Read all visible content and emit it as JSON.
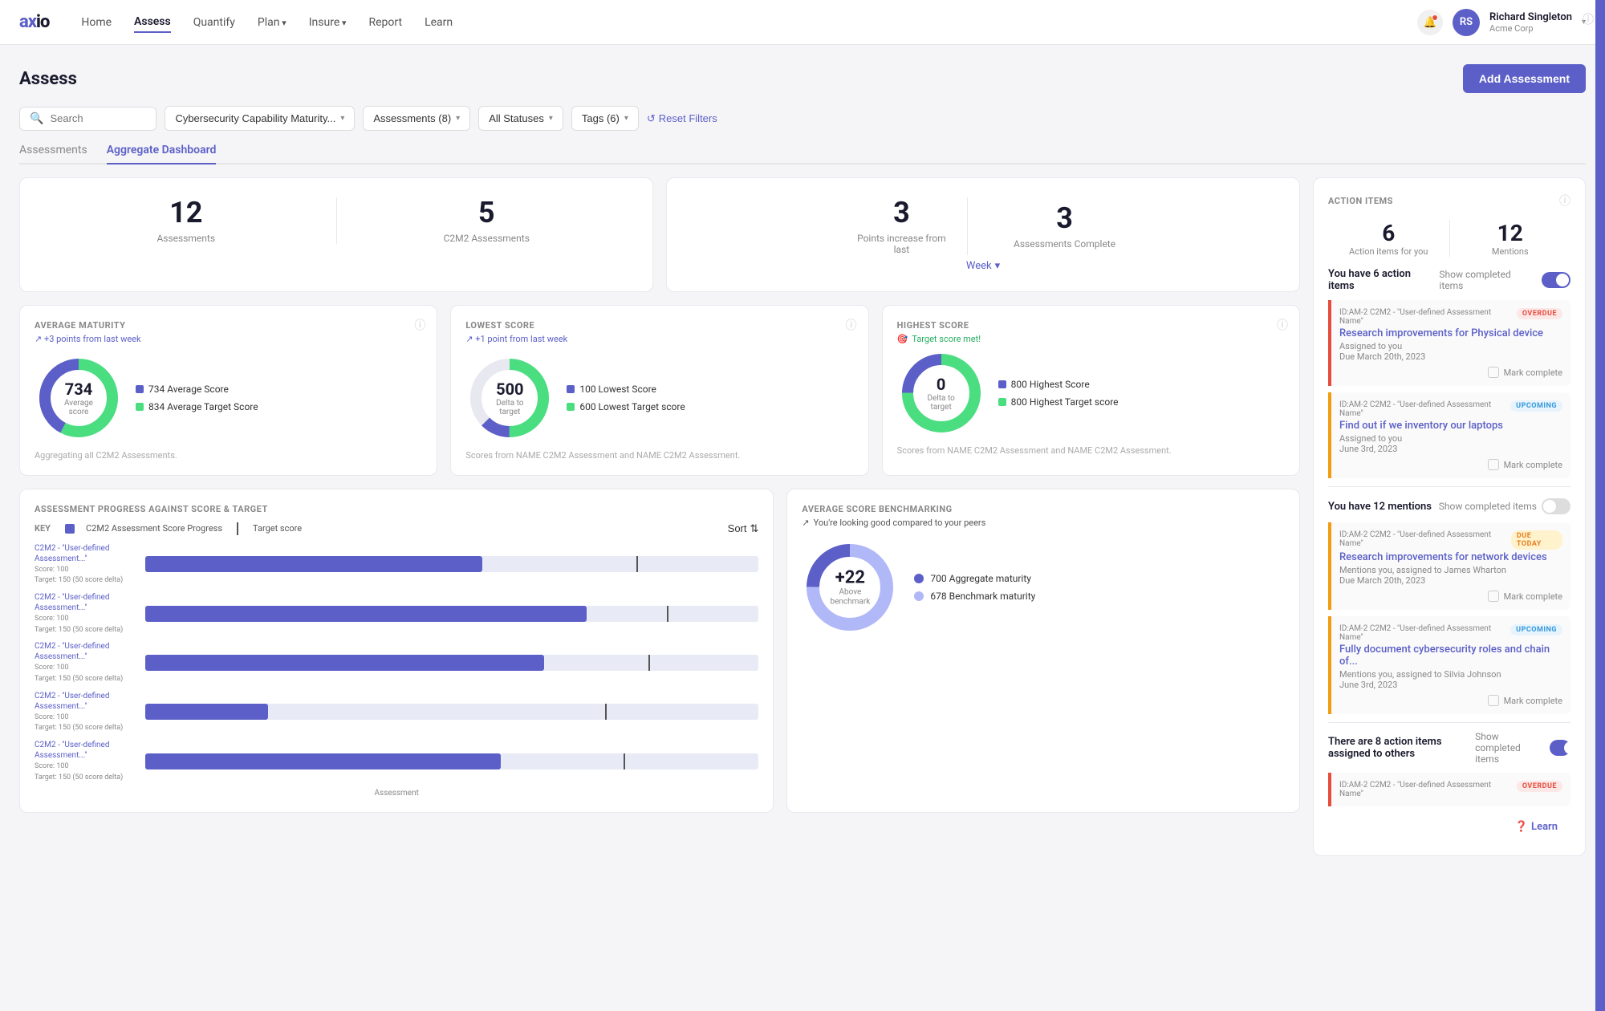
{
  "nav": {
    "logo": "axio",
    "links": [
      {
        "label": "Home",
        "active": false
      },
      {
        "label": "Assess",
        "active": true
      },
      {
        "label": "Quantify",
        "active": false
      },
      {
        "label": "Plan",
        "active": false,
        "hasArrow": true
      },
      {
        "label": "Insure",
        "active": false,
        "hasArrow": true
      },
      {
        "label": "Report",
        "active": false
      },
      {
        "label": "Learn",
        "active": false
      }
    ],
    "user": {
      "name": "Richard Singleton",
      "org": "Acme Corp",
      "initials": "RS"
    }
  },
  "page": {
    "title": "Assess",
    "add_button": "Add Assessment"
  },
  "filters": {
    "search_placeholder": "Search",
    "framework": "Cybersecurity Capability Maturity...",
    "assessments": "Assessments (8)",
    "statuses": "All Statuses",
    "tags": "Tags (6)",
    "reset": "Reset Filters"
  },
  "tabs": [
    {
      "label": "Assessments",
      "active": false
    },
    {
      "label": "Aggregate Dashboard",
      "active": true
    }
  ],
  "stats_card1": {
    "stat1_num": "12",
    "stat1_label": "Assessments",
    "stat2_num": "5",
    "stat2_label": "C2M2 Assessments"
  },
  "stats_card2": {
    "stat1_num": "3",
    "stat1_label": "Points increase from last",
    "period": "Week",
    "stat2_num": "3",
    "stat2_label": "Assessments Complete"
  },
  "avg_maturity": {
    "title": "AVERAGE MATURITY",
    "trend": "+3 points from last week",
    "donut_num": "734",
    "donut_label": "Average score",
    "legend": [
      {
        "color": "#5b5fc7",
        "label": "734 Average Score"
      },
      {
        "color": "#4ade80",
        "label": "834 Average Target Score"
      }
    ],
    "footer": "Aggregating all C2M2 Assessments."
  },
  "lowest_score": {
    "title": "LOWEST SCORE",
    "trend": "+1 point from last week",
    "donut_num": "500",
    "donut_label": "Delta to target",
    "legend": [
      {
        "color": "#5b5fc7",
        "label": "100 Lowest Score"
      },
      {
        "color": "#4ade80",
        "label": "600 Lowest Target score"
      }
    ],
    "footer": "Scores from NAME C2M2 Assessment and NAME C2M2 Assessment."
  },
  "highest_score": {
    "title": "HIGHEST SCORE",
    "trend": "Target score met!",
    "donut_num": "0",
    "donut_label": "Delta to target",
    "legend": [
      {
        "color": "#5b5fc7",
        "label": "800 Highest Score"
      },
      {
        "color": "#4ade80",
        "label": "800 Highest Target score"
      }
    ],
    "footer": "Scores from NAME C2M2 Assessment and NAME C2M2 Assessment."
  },
  "progress": {
    "title": "ASSESSMENT PROGRESS AGAINST SCORE & TARGET",
    "key_score": "C2M2 Assessment Score Progress",
    "key_target": "Target score",
    "sort_label": "Sort",
    "bars": [
      {
        "label": "C2M2 - \"User-defined Assessment...\"",
        "sub": "Score: 100\nTarget: 150 (50 score delta)",
        "score_pct": 55,
        "target_pct": 80
      },
      {
        "label": "C2M2 - \"User-defined Assessment...\"",
        "sub": "Score: 100\nTarget: 150 (50 score delta)",
        "score_pct": 72,
        "target_pct": 85
      },
      {
        "label": "C2M2 - \"User-defined Assessment...\"",
        "sub": "Score: 100\nTarget: 150 (50 score delta)",
        "score_pct": 65,
        "target_pct": 82
      },
      {
        "label": "C2M2 - \"User-defined Assessment...\"",
        "sub": "Score: 100\nTarget: 150 (50 score delta)",
        "score_pct": 20,
        "target_pct": 75
      },
      {
        "label": "C2M2 - \"User-defined Assessment...\"",
        "sub": "Score: 100\nTarget: 150 (50 score delta)",
        "score_pct": 58,
        "target_pct": 78
      }
    ]
  },
  "benchmarking": {
    "title": "AVERAGE SCORE BENCHMARKING",
    "subtitle": "You're looking good compared to your peers",
    "donut_num": "+22",
    "donut_label": "Above\nbenchmark",
    "legend": [
      {
        "color": "#5b5fc7",
        "label": "700 Aggregate maturity"
      },
      {
        "color": "#b0b8f8",
        "label": "678 Benchmark maturity"
      }
    ]
  },
  "action_items": {
    "title": "ACTION ITEMS",
    "count_num": "6",
    "count_label": "Action items for you",
    "mentions_num": "12",
    "mentions_label": "Mentions",
    "you_have": "You have 6 action items",
    "show_completed": "Show completed items",
    "items": [
      {
        "id": "ID:AM-2  C2M2 - \"User-defined Assessment Name\"",
        "title": "Research improvements for Physical device",
        "meta": "Assigned to you",
        "date": "Due March 20th, 2023",
        "badge": "OVERDUE",
        "badge_type": "overdue"
      },
      {
        "id": "ID:AM-2  C2M2 - \"User-defined Assessment Name\"",
        "title": "Find out if we inventory our laptops",
        "meta": "Assigned to you",
        "date": "June 3rd, 2023",
        "badge": "UPCOMING",
        "badge_type": "upcoming"
      }
    ],
    "mentions_label_text": "You have 12 mentions",
    "mentions_items": [
      {
        "id": "ID:AM-2  C2M2 - \"User-defined Assessment Name\"",
        "title": "Research improvements for network devices",
        "meta": "Mentions you, assigned to James Wharton",
        "date": "Due March 20th, 2023",
        "badge": "DUE TODAY",
        "badge_type": "due-today"
      },
      {
        "id": "ID:AM-2  C2M2 - \"User-defined Assessment Name\"",
        "title": "Fully document cybersecurity roles and chain of...",
        "meta": "Mentions you, assigned to Silvia Johnson",
        "date": "June 3rd, 2023",
        "badge": "UPCOMING",
        "badge_type": "upcoming"
      }
    ],
    "others_label": "There are 8 action items assigned to others",
    "others_item": {
      "id": "ID:AM-2  C2M2 - \"User-defined Assessment Name\"",
      "badge": "OVERDUE",
      "badge_type": "overdue"
    },
    "learn_label": "Learn"
  }
}
